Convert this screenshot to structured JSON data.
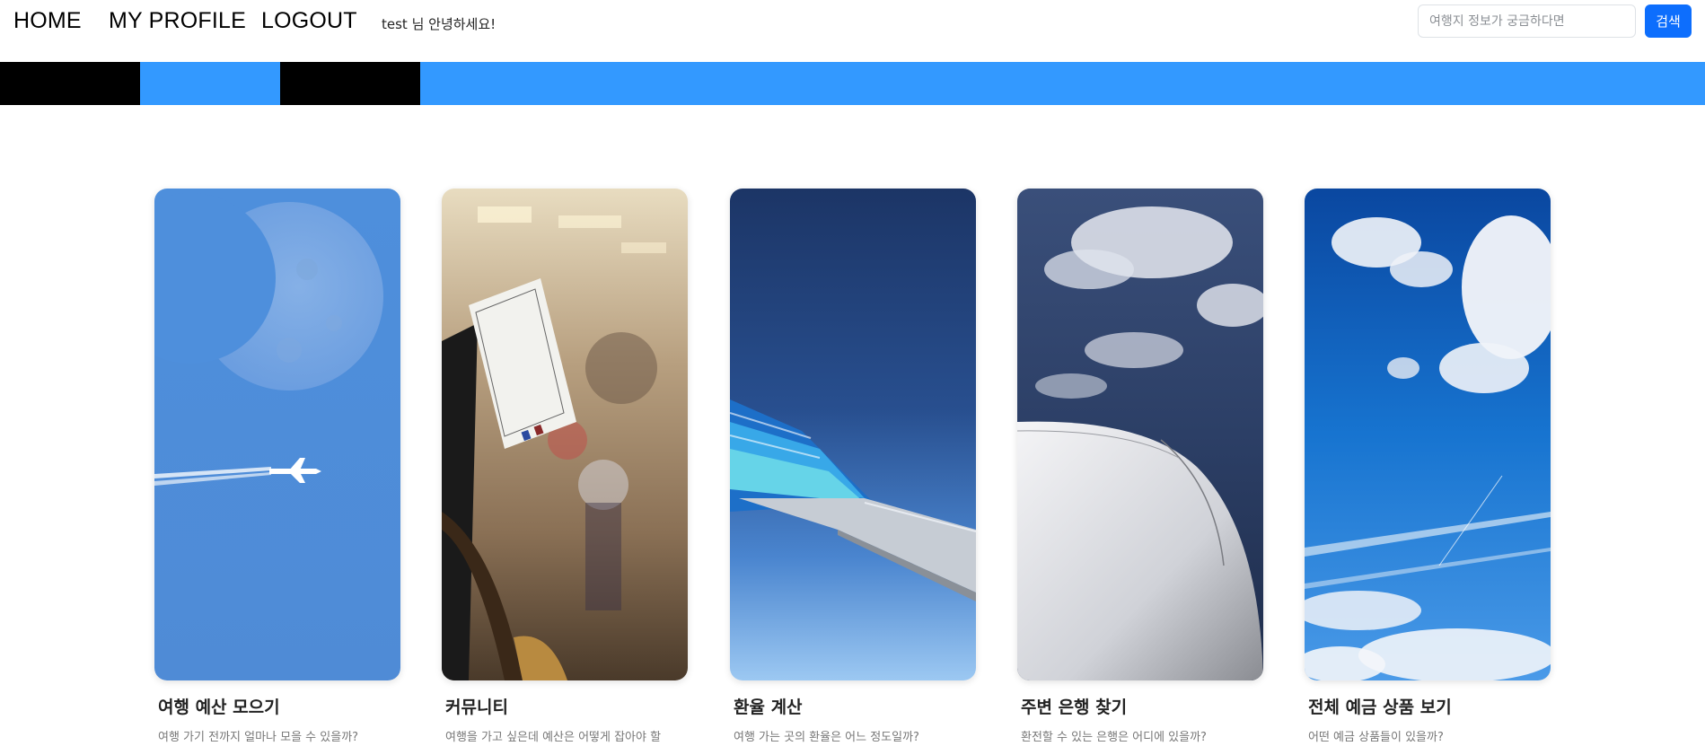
{
  "nav": {
    "home": "HOME",
    "profile": "MY PROFILE",
    "logout": "LOGOUT",
    "greeting": "test 님 안녕하세요!"
  },
  "search": {
    "placeholder": "여행지 정보가 궁금하다면",
    "value": "",
    "button_label": "검색"
  },
  "banner": {
    "colors": [
      "#000000",
      "#3399ff",
      "#000000",
      "#3399ff"
    ]
  },
  "cards": [
    {
      "title": "여행 예산 모으기",
      "description": "여행 가기 전까지 얼마나 모을 수 있을까?",
      "image": "moon-airplane-sky"
    },
    {
      "title": "커뮤니티",
      "description": "여행을 가고 싶은데 예산은 어떻게 잡아야 할",
      "image": "boarding-pass-airport"
    },
    {
      "title": "환율 계산",
      "description": "여행 가는 곳의 환율은 어느 정도일까?",
      "image": "airplane-tail-wing"
    },
    {
      "title": "주변 은행 찾기",
      "description": "환전할 수 있는 은행은 어디에 있을까?",
      "image": "airplane-engine-clouds"
    },
    {
      "title": "전체 예금 상품 보기",
      "description": "어떤 예금 상품들이 있을까?",
      "image": "blue-sky-clouds"
    }
  ],
  "colors": {
    "accent": "#0d6efd",
    "banner_blue": "#3399ff",
    "banner_black": "#000000"
  }
}
